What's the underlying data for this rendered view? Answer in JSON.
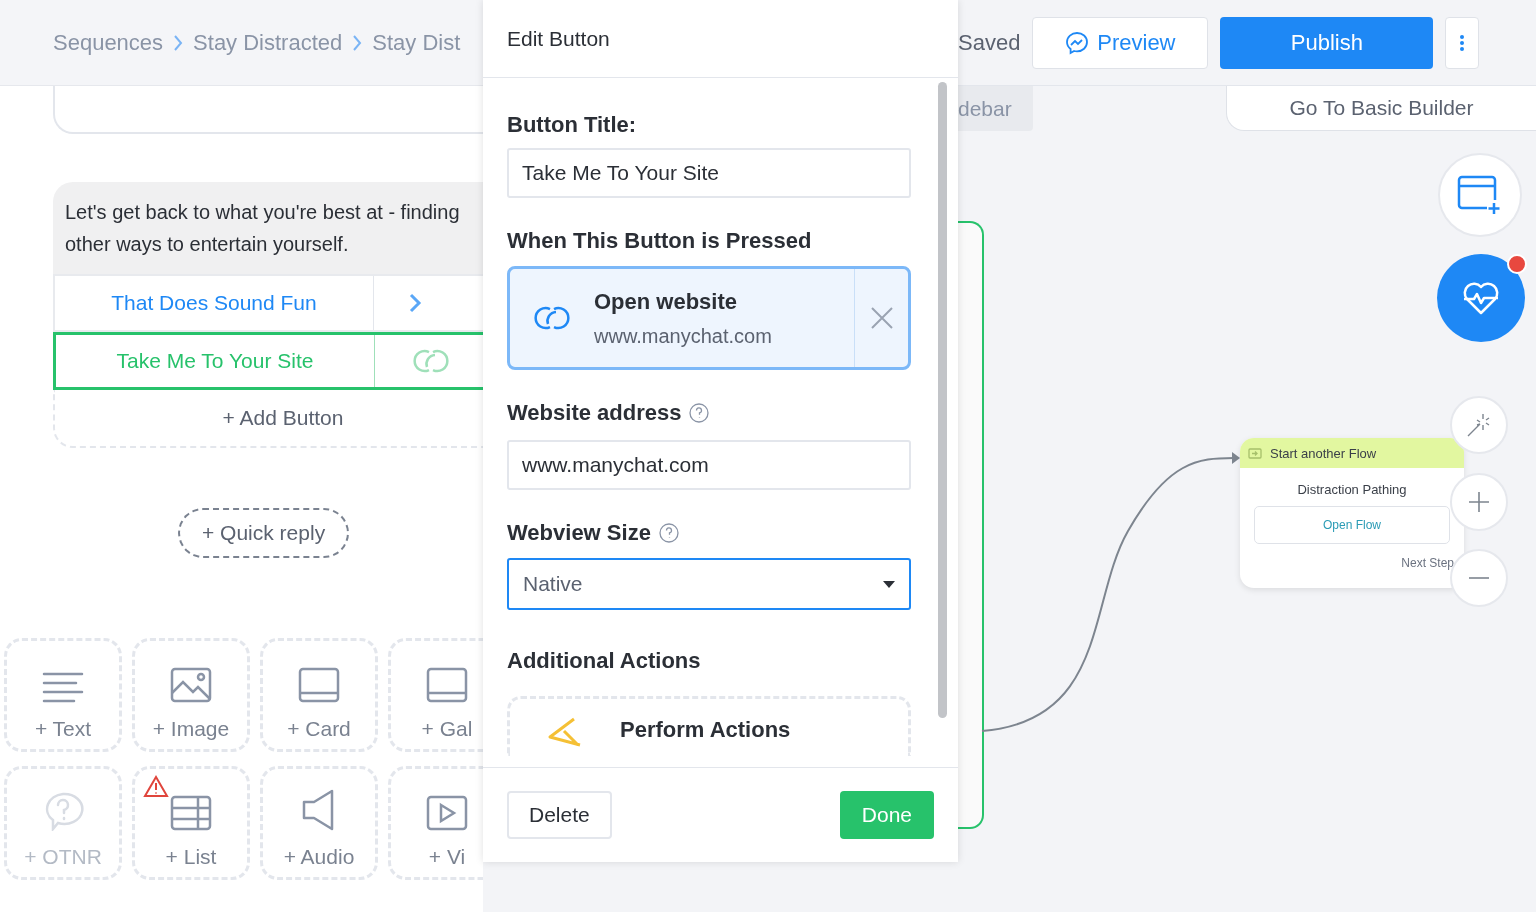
{
  "breadcrumbs": [
    "Sequences",
    "Stay Distracted",
    "Stay Dist"
  ],
  "message": {
    "text": "Let's get back to what you're best at - finding other ways to entertain yourself.",
    "add_button": "+ Add Button",
    "buttons": [
      {
        "label": "That Does Sound Fun",
        "kind": "next",
        "selected": false
      },
      {
        "label": "Take Me To Your Site",
        "kind": "link",
        "selected": true
      }
    ]
  },
  "quick_reply": "+ Quick reply",
  "blocks": [
    {
      "label": "+ Text",
      "kind": "text",
      "disabled": false,
      "warning": false
    },
    {
      "label": "+ Image",
      "kind": "image",
      "disabled": false,
      "warning": false
    },
    {
      "label": "+ Card",
      "kind": "card",
      "disabled": false,
      "warning": false
    },
    {
      "label": "+ Gal",
      "kind": "gallery",
      "disabled": false,
      "warning": false
    },
    {
      "label": "+ OTNR",
      "kind": "otnr",
      "disabled": true,
      "warning": false
    },
    {
      "label": "+ List",
      "kind": "list",
      "disabled": false,
      "warning": true
    },
    {
      "label": "+ Audio",
      "kind": "audio",
      "disabled": false,
      "warning": false
    },
    {
      "label": "+ Vi",
      "kind": "video",
      "disabled": false,
      "warning": false
    }
  ],
  "editor": {
    "title": "Edit Button",
    "button_title_label": "Button Title:",
    "button_title": "Take Me To Your Site",
    "action_label": "When This Button is Pressed",
    "action": {
      "title": "Open website",
      "subtitle": "www.manychat.com"
    },
    "address_label": "Website address",
    "address": "www.manychat.com",
    "webview_label": "Webview Size",
    "webview": "Native",
    "additional_label": "Additional Actions",
    "perform": "Perform Actions",
    "delete": "Delete",
    "done": "Done"
  },
  "toolbar": {
    "status": "Saved",
    "preview": "Preview",
    "publish": "Publish"
  },
  "sidebar_tab": "debar",
  "basic_builder": "Go To Basic Builder",
  "health_alert": true,
  "flow_node": {
    "header": "Start another Flow",
    "name": "Distraction Pathing",
    "button": "Open Flow",
    "next": "Next Step"
  }
}
